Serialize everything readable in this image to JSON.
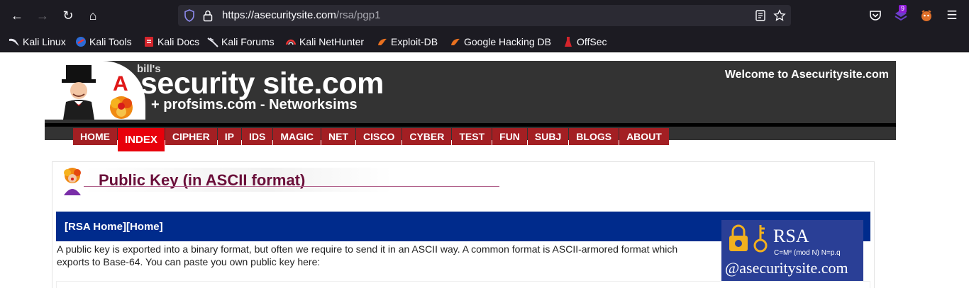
{
  "browser": {
    "url_host": "https://asecuritysite.com",
    "url_path": "/rsa/pgp1",
    "extensions_badge": "9",
    "bookmarks": [
      {
        "label": "Kali Linux",
        "icon": "kali-dragon-icon"
      },
      {
        "label": "Kali Tools",
        "icon": "kali-tools-icon"
      },
      {
        "label": "Kali Docs",
        "icon": "kali-docs-icon"
      },
      {
        "label": "Kali Forums",
        "icon": "kali-forums-icon"
      },
      {
        "label": "Kali NetHunter",
        "icon": "nethunter-icon"
      },
      {
        "label": "Exploit-DB",
        "icon": "exploit-db-icon"
      },
      {
        "label": "Google Hacking DB",
        "icon": "ghdb-icon"
      },
      {
        "label": "OffSec",
        "icon": "offsec-icon"
      }
    ]
  },
  "site": {
    "logo_small": "bill's",
    "logo_main": "security site.com",
    "logo_letter": "A",
    "logo_sub": "+ profsims.com - Networksims",
    "welcome": "Welcome to Asecuritysite.com",
    "menu": [
      "HOME",
      "INDEX",
      "CIPHER",
      "IP",
      "IDS",
      "MAGIC",
      "NET",
      "CISCO",
      "CYBER",
      "TEST",
      "FUN",
      "SUBJ",
      "BLOGS",
      "ABOUT"
    ],
    "active_menu": "INDEX"
  },
  "content": {
    "title": "Public Key (in ASCII format)",
    "links": [
      "[RSA Home]",
      "[Home]"
    ],
    "intro": "A public key is exported into a binary format, but often we require to send it in an ASCII way. A common format is ASCII-armored format which exports to Base-64. You can paste you own public key here:",
    "rsa_badge": {
      "title": "RSA",
      "formula": "C=Mᵉ (mod N) N=p.q",
      "handle": "@asecuritysite.com"
    }
  },
  "colors": {
    "chrome_bg": "#1c1b22",
    "banner_bg": "#333333",
    "menu_red": "#a31f23",
    "menu_active": "#e8000b",
    "title_color": "#6a0f3a",
    "bluebar": "#002b8c"
  }
}
